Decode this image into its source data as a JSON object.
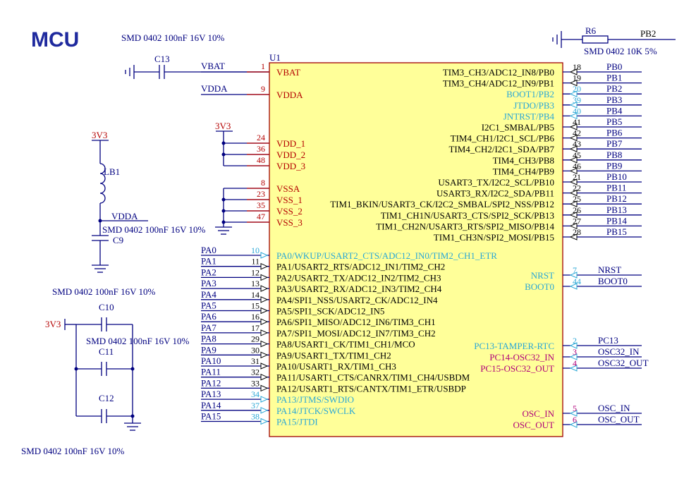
{
  "title": "MCU",
  "colors": {
    "wire": "#000080",
    "chip_fill": "#ffff99",
    "chip_border": "#a00000",
    "pin_red": "#b40000",
    "cyan": "#2aa7d6",
    "magenta": "#b0007a"
  },
  "notes": {
    "top_cap": "SMD 0402 100nF 16V 10%",
    "mid_cap": "SMD 0402 100nF 16V 10%",
    "lb_cap": "SMD 0402 100nF 16V 10%",
    "bottom_caps_a": "SMD 0402 100nF 16V 10%",
    "bottom_caps_b": "SMD 0402 100nF 16V 10%",
    "bottom_caps_c": "SMD 0402 100nF 16V 10%",
    "r6_value": "SMD 0402 10K 5%"
  },
  "parts": {
    "u1": "U1",
    "c13": "C13",
    "r6": "R6",
    "lb1": "LB1",
    "c9": "C9",
    "c10": "C10",
    "c11": "C11",
    "c12": "C12",
    "vcc_a": "3V3",
    "vcc_b": "3V3",
    "vcc_c": "3V3",
    "vdda_net": "VDDA",
    "r6_net": "PB2"
  },
  "power_left": [
    {
      "net": "VBAT",
      "num": "1",
      "pin": "VBAT"
    },
    {
      "net": "VDDA",
      "num": "9",
      "pin": "VDDA"
    },
    {
      "net": "",
      "num": "24",
      "pin": "VDD_1"
    },
    {
      "net": "",
      "num": "36",
      "pin": "VDD_2"
    },
    {
      "net": "",
      "num": "48",
      "pin": "VDD_3"
    },
    {
      "net": "",
      "num": "8",
      "pin": "VSSA"
    },
    {
      "net": "",
      "num": "23",
      "pin": "VSS_1"
    },
    {
      "net": "",
      "num": "35",
      "pin": "VSS_2"
    },
    {
      "net": "",
      "num": "47",
      "pin": "VSS_3"
    }
  ],
  "pa_pins": [
    {
      "net": "PA0",
      "num": "10",
      "pin": "PA0/WKUP/USART2_CTS/ADC12_IN0/TIM2_CH1_ETR",
      "c": "cyan"
    },
    {
      "net": "PA1",
      "num": "11",
      "pin": "PA1/USART2_RTS/ADC12_IN1/TIM2_CH2",
      "c": "blk"
    },
    {
      "net": "PA2",
      "num": "12",
      "pin": "PA2/USART2_TX/ADC12_IN2/TIM2_CH3",
      "c": "blk"
    },
    {
      "net": "PA3",
      "num": "13",
      "pin": "PA3/USART2_RX/ADC12_IN3/TIM2_CH4",
      "c": "blk"
    },
    {
      "net": "PA4",
      "num": "14",
      "pin": "PA4/SPI1_NSS/USART2_CK/ADC12_IN4",
      "c": "blk"
    },
    {
      "net": "PA5",
      "num": "15",
      "pin": "PA5/SPI1_SCK/ADC12_IN5",
      "c": "blk"
    },
    {
      "net": "PA6",
      "num": "16",
      "pin": "PA6/SPI1_MISO/ADC12_IN6/TIM3_CH1",
      "c": "blk"
    },
    {
      "net": "PA7",
      "num": "17",
      "pin": "PA7/SPI1_MOSI/ADC12_IN7/TIM3_CH2",
      "c": "blk"
    },
    {
      "net": "PA8",
      "num": "29",
      "pin": "PA8/USART1_CK/TIM1_CH1/MCO",
      "c": "blk"
    },
    {
      "net": "PA9",
      "num": "30",
      "pin": "PA9/USART1_TX/TIM1_CH2",
      "c": "blk"
    },
    {
      "net": "PA10",
      "num": "31",
      "pin": "PA10/USART1_RX/TIM1_CH3",
      "c": "blk"
    },
    {
      "net": "PA11",
      "num": "32",
      "pin": "PA11/USART1_CTS/CANRX/TIM1_CH4/USBDM",
      "c": "blk"
    },
    {
      "net": "PA12",
      "num": "33",
      "pin": "PA12/USART1_RTS/CANTX/TIM1_ETR/USBDP",
      "c": "blk"
    },
    {
      "net": "PA13",
      "num": "34",
      "pin": "PA13/JTMS/SWDIO",
      "c": "cyan"
    },
    {
      "net": "PA14",
      "num": "37",
      "pin": "PA14/JTCK/SWCLK",
      "c": "cyan"
    },
    {
      "net": "PA15",
      "num": "38",
      "pin": "PA15/JTDI",
      "c": "cyan"
    }
  ],
  "pb_pins": [
    {
      "net": "PB0",
      "num": "18",
      "pin": "TIM3_CH3/ADC12_IN8/PB0",
      "c": "blk"
    },
    {
      "net": "PB1",
      "num": "19",
      "pin": "TIM3_CH4/ADC12_IN9/PB1",
      "c": "blk"
    },
    {
      "net": "PB2",
      "num": "20",
      "pin": "BOOT1/PB2",
      "c": "cyan"
    },
    {
      "net": "PB3",
      "num": "39",
      "pin": "JTDO/PB3",
      "c": "cyan"
    },
    {
      "net": "PB4",
      "num": "40",
      "pin": "JNTRST/PB4",
      "c": "cyan"
    },
    {
      "net": "PB5",
      "num": "41",
      "pin": "I2C1_SMBAL/PB5",
      "c": "blk"
    },
    {
      "net": "PB6",
      "num": "42",
      "pin": "TIM4_CH1/I2C1_SCL/PB6",
      "c": "blk"
    },
    {
      "net": "PB7",
      "num": "43",
      "pin": "TIM4_CH2/I2C1_SDA/PB7",
      "c": "blk"
    },
    {
      "net": "PB8",
      "num": "45",
      "pin": "TIM4_CH3/PB8",
      "c": "blk"
    },
    {
      "net": "PB9",
      "num": "46",
      "pin": "TIM4_CH4/PB9",
      "c": "blk"
    },
    {
      "net": "PB10",
      "num": "21",
      "pin": "USART3_TX/I2C2_SCL/PB10",
      "c": "blk"
    },
    {
      "net": "PB11",
      "num": "22",
      "pin": "USART3_RX/I2C2_SDA/PB11",
      "c": "blk"
    },
    {
      "net": "PB12",
      "num": "25",
      "pin": "TIM1_BKIN/USART3_CK/I2C2_SMBAL/SPI2_NSS/PB12",
      "c": "blk"
    },
    {
      "net": "PB13",
      "num": "26",
      "pin": "TIM1_CH1N/USART3_CTS/SPI2_SCK/PB13",
      "c": "blk"
    },
    {
      "net": "PB14",
      "num": "27",
      "pin": "TIM1_CH2N/USART3_RTS/SPI2_MISO/PB14",
      "c": "blk"
    },
    {
      "net": "PB15",
      "num": "28",
      "pin": "TIM1_CH3N/SPI2_MOSI/PB15",
      "c": "blk"
    }
  ],
  "misc_right": [
    {
      "net": "NRST",
      "num": "7",
      "pin": "NRST",
      "c": "cyan"
    },
    {
      "net": "BOOT0",
      "num": "44",
      "pin": "BOOT0",
      "c": "cyan"
    },
    {
      "net": "PC13",
      "num": "2",
      "pin": "PC13-TAMPER-RTC",
      "c": "cyan"
    },
    {
      "net": "OSC32_IN",
      "num": "3",
      "pin": "PC14-OSC32_IN",
      "c": "mag"
    },
    {
      "net": "OSC32_OUT",
      "num": "4",
      "pin": "PC15-OSC32_OUT",
      "c": "mag"
    },
    {
      "net": "OSC_IN",
      "num": "5",
      "pin": "OSC_IN",
      "c": "mag"
    },
    {
      "net": "OSC_OUT",
      "num": "6",
      "pin": "OSC_OUT",
      "c": "mag"
    }
  ]
}
